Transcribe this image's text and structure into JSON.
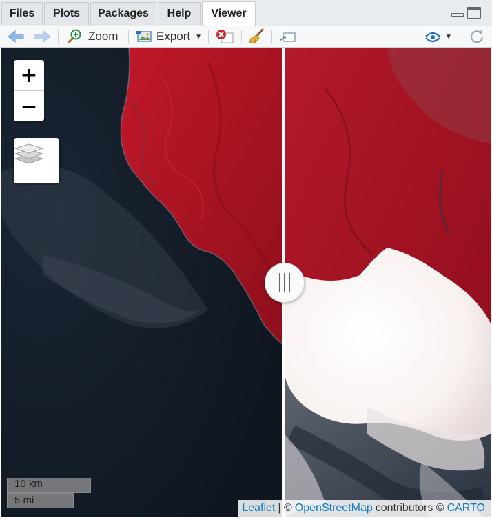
{
  "tabs": [
    {
      "label": "Files",
      "active": false
    },
    {
      "label": "Plots",
      "active": false
    },
    {
      "label": "Packages",
      "active": false
    },
    {
      "label": "Help",
      "active": false
    },
    {
      "label": "Viewer",
      "active": true
    }
  ],
  "toolbar": {
    "zoom_label": "Zoom",
    "export_label": "Export"
  },
  "map": {
    "zoom_in": "+",
    "zoom_out": "−",
    "scale_km": "10 km",
    "scale_mi": "5 mi",
    "attribution": {
      "leaflet": "Leaflet",
      "sep1": "| ©",
      "osm": "OpenStreetMap",
      "contributors": "contributors ©",
      "carto": "CARTO"
    }
  },
  "colors": {
    "vegetation_red": "#b0141f",
    "ocean": "#121a26",
    "cloud": "#fbf8f7",
    "link": "#0f7bc4"
  }
}
